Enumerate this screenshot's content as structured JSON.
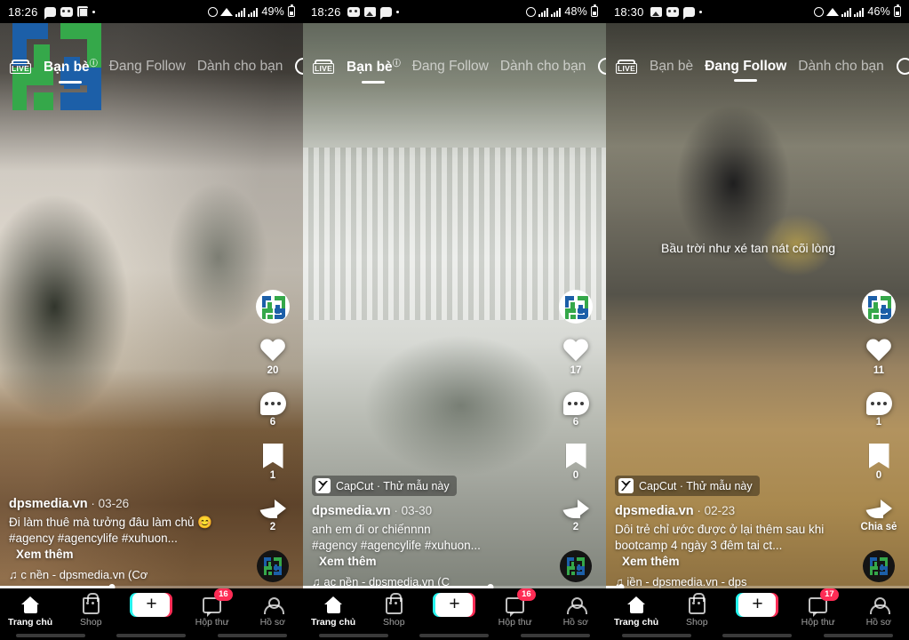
{
  "app": {
    "name": "TikTok",
    "platform": "Android"
  },
  "panels": [
    {
      "id": "panel-1",
      "status_bar": {
        "time": "18:26",
        "icons": [
          "chat-icon",
          "mask-icon",
          "grid-icon",
          "more-dot-icon"
        ],
        "right_icons": [
          "alarm-icon",
          "wifi-icon",
          "signal-bars-icon",
          "signal-bars-icon"
        ],
        "battery": "49%"
      },
      "top_nav": {
        "live_label": "LIVE",
        "tabs": [
          {
            "label": "Bạn bè",
            "active": true,
            "info": "ⓘ"
          },
          {
            "label": "Đang Follow",
            "active": false
          },
          {
            "label": "Dành cho bạn",
            "active": false
          }
        ],
        "search_icon": "search-icon"
      },
      "watermark": {
        "type": "dps-logo",
        "colors": [
          "#1c5fa8",
          "#35a84a"
        ]
      },
      "video_overlay_text": "",
      "capcut_badge": null,
      "caption": {
        "username": "dpsmedia.vn",
        "date": "03-26",
        "text_line1": "Đi làm thuê mà tưởng đâu làm chủ 😊",
        "text_line2": "#agency #agencylife #xuhuon...",
        "more_label": "Xem thêm",
        "music": "♫ c nền - dpsmedia.vn (Cơ"
      },
      "actions": {
        "avatar": "dps-avatar",
        "like": {
          "icon": "heart-icon",
          "count": "20"
        },
        "comment": {
          "icon": "comment-icon",
          "count": "6"
        },
        "bookmark": {
          "icon": "bookmark-icon",
          "count": "1"
        },
        "share": {
          "icon": "share-icon",
          "count": "2"
        },
        "disc": "music-disc-icon"
      },
      "progress_percent": 37,
      "bottom_nav": {
        "items": [
          {
            "label": "Trang chủ",
            "icon": "home-icon",
            "active": true,
            "badge": ""
          },
          {
            "label": "Shop",
            "icon": "shop-icon",
            "active": false,
            "badge": ""
          },
          {
            "label": "",
            "icon": "create-plus-icon",
            "active": false,
            "badge": ""
          },
          {
            "label": "Hộp thư",
            "icon": "inbox-icon",
            "active": false,
            "badge": "16"
          },
          {
            "label": "Hồ sơ",
            "icon": "profile-icon",
            "active": false,
            "badge": ""
          }
        ]
      }
    },
    {
      "id": "panel-2",
      "status_bar": {
        "time": "18:26",
        "icons": [
          "mask-icon",
          "photo-icon",
          "chat-icon",
          "more-dot-icon"
        ],
        "right_icons": [
          "alarm-icon",
          "signal-bars-icon",
          "signal-bars-icon"
        ],
        "battery": "48%"
      },
      "top_nav": {
        "live_label": "LIVE",
        "tabs": [
          {
            "label": "Bạn bè",
            "active": true,
            "info": "ⓘ"
          },
          {
            "label": "Đang Follow",
            "active": false
          },
          {
            "label": "Dành cho bạn",
            "active": false
          }
        ],
        "search_icon": "search-icon"
      },
      "watermark": null,
      "video_overlay_text": "",
      "capcut_badge": {
        "app": "CapCut",
        "separator": "·",
        "action": "Thử mẫu này"
      },
      "caption": {
        "username": "dpsmedia.vn",
        "date": "03-30",
        "text_line1": "anh em đi or chiếnnnn",
        "text_line2": "#agency #agencylife #xuhuon...",
        "more_label": "Xem thêm",
        "music": "♫ ạc nền - dpsmedia.vn (C"
      },
      "actions": {
        "avatar": "dps-avatar",
        "like": {
          "icon": "heart-icon",
          "count": "17"
        },
        "comment": {
          "icon": "comment-icon",
          "count": "6"
        },
        "bookmark": {
          "icon": "bookmark-icon",
          "count": "0"
        },
        "share": {
          "icon": "share-icon",
          "count": "2"
        },
        "disc": "music-disc-icon"
      },
      "progress_percent": 62,
      "bottom_nav": {
        "items": [
          {
            "label": "Trang chủ",
            "icon": "home-icon",
            "active": true,
            "badge": ""
          },
          {
            "label": "Shop",
            "icon": "shop-icon",
            "active": false,
            "badge": ""
          },
          {
            "label": "",
            "icon": "create-plus-icon",
            "active": false,
            "badge": ""
          },
          {
            "label": "Hộp thư",
            "icon": "inbox-icon",
            "active": false,
            "badge": "16"
          },
          {
            "label": "Hồ sơ",
            "icon": "profile-icon",
            "active": false,
            "badge": ""
          }
        ]
      }
    },
    {
      "id": "panel-3",
      "status_bar": {
        "time": "18:30",
        "icons": [
          "photo-icon",
          "mask-icon",
          "chat-icon",
          "more-dot-icon"
        ],
        "right_icons": [
          "alarm-icon",
          "wifi-icon",
          "signal-bars-icon",
          "signal-bars-icon"
        ],
        "battery": "46%"
      },
      "top_nav": {
        "live_label": "LIVE",
        "tabs": [
          {
            "label": "Bạn bè",
            "active": false
          },
          {
            "label": "Đang Follow",
            "active": true
          },
          {
            "label": "Dành cho bạn",
            "active": false
          }
        ],
        "search_icon": "search-icon"
      },
      "watermark": null,
      "video_overlay_text": "Bầu trời như xé tan nát cõi lòng",
      "capcut_badge": {
        "app": "CapCut",
        "separator": "·",
        "action": "Thử mẫu này"
      },
      "caption": {
        "username": "dpsmedia.vn",
        "date": "02-23",
        "text_line1": "Dôi trẻ chỉ ước được ở lại thêm sau khi",
        "text_line2": "bootcamp 4 ngày 3 đêm tai ct...",
        "more_label": "Xem thêm",
        "music": "♫ iền - dpsmedia.vn - dps"
      },
      "actions": {
        "avatar": "dps-avatar",
        "like": {
          "icon": "heart-icon",
          "count": "11"
        },
        "comment": {
          "icon": "comment-icon",
          "count": "1"
        },
        "bookmark": {
          "icon": "bookmark-icon",
          "count": "0"
        },
        "share": {
          "icon": "share-icon",
          "count": "Chia sẻ"
        },
        "disc": "music-disc-icon"
      },
      "progress_percent": 5,
      "bottom_nav": {
        "items": [
          {
            "label": "Trang chủ",
            "icon": "home-icon",
            "active": true,
            "badge": ""
          },
          {
            "label": "Shop",
            "icon": "shop-icon",
            "active": false,
            "badge": ""
          },
          {
            "label": "",
            "icon": "create-plus-icon",
            "active": false,
            "badge": ""
          },
          {
            "label": "Hộp thư",
            "icon": "inbox-icon",
            "active": false,
            "badge": "17"
          },
          {
            "label": "Hồ sơ",
            "icon": "profile-icon",
            "active": false,
            "badge": ""
          }
        ]
      }
    }
  ],
  "colors": {
    "accent_pink": "#fe2c55",
    "accent_cyan": "#25f4ee",
    "logo_blue": "#1c5fa8",
    "logo_green": "#35a84a",
    "nav_background": "#000000"
  }
}
